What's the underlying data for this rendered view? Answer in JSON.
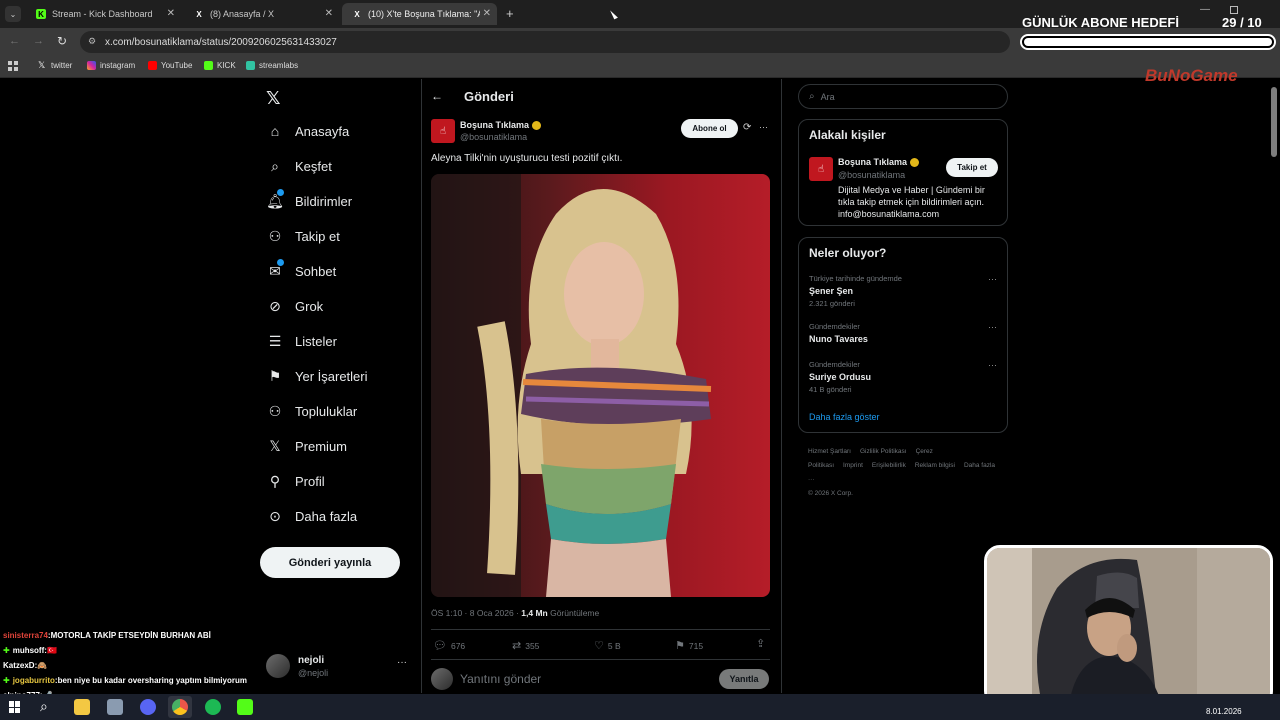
{
  "browser": {
    "tabs": [
      {
        "title": "Stream - Kick Dashboard",
        "favicon": "K"
      },
      {
        "title": "(8) Anasayfa / X",
        "favicon": "X"
      },
      {
        "title": "(10) X'te Boşuna Tıklama: \"Aley",
        "favicon": "X"
      }
    ],
    "url": "x.com/bosunatiklama/status/2009206025631433027",
    "bookmarks": [
      "twitter",
      "instagram",
      "YouTube",
      "KICK",
      "streamlabs"
    ]
  },
  "x": {
    "nav": [
      {
        "label": "Anasayfa",
        "icon": "home-icon"
      },
      {
        "label": "Keşfet",
        "icon": "search-icon"
      },
      {
        "label": "Bildirimler",
        "icon": "bell-icon"
      },
      {
        "label": "Takip et",
        "icon": "person-add-icon"
      },
      {
        "label": "Sohbet",
        "icon": "mail-icon"
      },
      {
        "label": "Grok",
        "icon": "grok-icon"
      },
      {
        "label": "Listeler",
        "icon": "list-icon"
      },
      {
        "label": "Yer İşaretleri",
        "icon": "bookmark-icon"
      },
      {
        "label": "Topluluklar",
        "icon": "communities-icon"
      },
      {
        "label": "Premium",
        "icon": "x-logo-icon"
      },
      {
        "label": "Profil",
        "icon": "profile-icon"
      },
      {
        "label": "Daha fazla",
        "icon": "more-circle-icon"
      }
    ],
    "post_button": "Gönderi yayınla",
    "account": {
      "name": "nejoli",
      "handle": "@nejoli"
    },
    "header_title": "Gönderi",
    "tweet": {
      "author_name": "Boşuna Tıklama",
      "author_handle": "@bosunatiklama",
      "subscribe_label": "Abone ol",
      "text": "Aleyna Tilki'nin uyuşturucu testi pozitif çıktı.",
      "time": "ÖS 1:10 · 8 Oca 2026 ·",
      "views": "1,4 Mn",
      "views_label": "Görüntüleme",
      "replies": "676",
      "retweets": "355",
      "likes": "5 B",
      "bookmarks": "715",
      "reply_placeholder": "Yanıtını gönder",
      "reply_button": "Yanıtla"
    },
    "search_placeholder": "Ara",
    "related": {
      "title": "Alakalı kişiler",
      "name": "Boşuna Tıklama",
      "handle": "@bosunatiklama",
      "follow_label": "Takip et",
      "bio": "Dijital Medya ve Haber | Gündemi bir tıkla takip etmek için bildirimleri açın. info@bosunatiklama.com"
    },
    "trends": {
      "title": "Neler oluyor?",
      "items": [
        {
          "context": "Türkiye tarihinde gündemde",
          "name": "Şener Şen",
          "count": "2.321 gönderi"
        },
        {
          "context": "Gündemdekiler",
          "name": "Nuno Tavares",
          "count": ""
        },
        {
          "context": "Gündemdekiler",
          "name": "Suriye Ordusu",
          "count": "41 B gönderi"
        }
      ],
      "show_more": "Daha fazla göster"
    },
    "footer": {
      "links": [
        "Hizmet Şartları",
        "Gizlilik Politikası",
        "Çerez Politikası",
        "Imprint",
        "Erişilebilirlik",
        "Reklam bilgisi",
        "Daha fazla ···"
      ],
      "copyright": "© 2026 X Corp."
    }
  },
  "overlay": {
    "goal_title": "GÜNLÜK ABONE HEDEFİ",
    "goal_count": "29  / 10",
    "logo": "BuNoGame",
    "chat": [
      {
        "user": "sinisterra74",
        "color": "#e0443a",
        "badge": false,
        "text": "MOTORLA TAKİP ETSEYDİN BURHAN ABİ"
      },
      {
        "user": "muhsoff",
        "color": "#ffffff",
        "badge": true,
        "text": "🇹🇷"
      },
      {
        "user": "KatzexD",
        "color": "#ffffff",
        "badge": false,
        "text": "🙈"
      },
      {
        "user": "jogaburrito",
        "color": "#e6c640",
        "badge": true,
        "text": "ben niye bu kadar oversharing yaptım bilmiyorum"
      },
      {
        "user": "elnino777",
        "color": "#ffffff",
        "badge": false,
        "text": "🎤"
      }
    ]
  },
  "taskbar": {
    "date": "8.01.2026"
  }
}
